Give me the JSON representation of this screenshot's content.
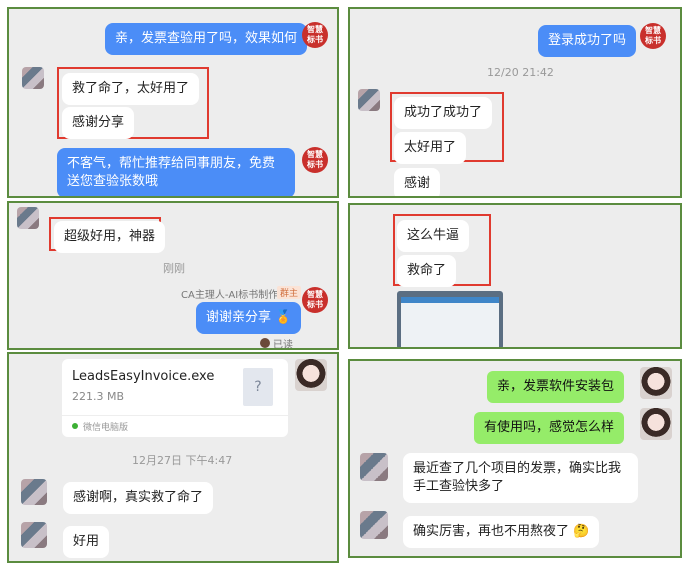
{
  "panel1": {
    "out_msg": "亲，发票查验用了吗，效果如何",
    "in_1": "救了命了，太好用了",
    "in_2": "感谢分享",
    "out_reply": "不客气，帮忙推荐给同事朋友，免费送您查验张数哦",
    "badge": "智慧标书"
  },
  "panel2": {
    "out_msg": "登录成功了吗",
    "timestamp": "12/20 21:42",
    "in_1": "成功了成功了",
    "in_2": "太好用了",
    "in_3": "感谢",
    "badge": "智慧标书"
  },
  "panel3": {
    "in_1": "超级好用，神器",
    "timestamp": "刚刚",
    "sender_name": "CA主理人-AI标书制作",
    "sender_tag": "群主",
    "out_msg": "谢谢亲分享",
    "read_status": "已读",
    "badge": "智慧标书"
  },
  "panel4": {
    "in_1": "这么牛逼",
    "in_2": "救命了"
  },
  "panel5": {
    "file_name": "LeadsEasyInvoice.exe",
    "file_size": "221.3 MB",
    "file_source": "微信电脑版",
    "file_icon": "?",
    "timestamp": "12月27日 下午4:47",
    "in_1": "感谢啊，真实救了命了",
    "in_2": "好用"
  },
  "panel6": {
    "out_1": "亲，发票软件安装包",
    "out_2": "有使用吗，感觉怎么样",
    "in_1": "最近查了几个项目的发票，确实比我手工查验快多了",
    "in_2": "确实厉害，再也不用熬夜了"
  },
  "colors": {
    "panel_border": "#5b8c3f",
    "highlight": "#e03a2f",
    "blue_bubble": "#4b8df7",
    "green_bubble": "#95ec69",
    "badge": "#c9302c"
  }
}
